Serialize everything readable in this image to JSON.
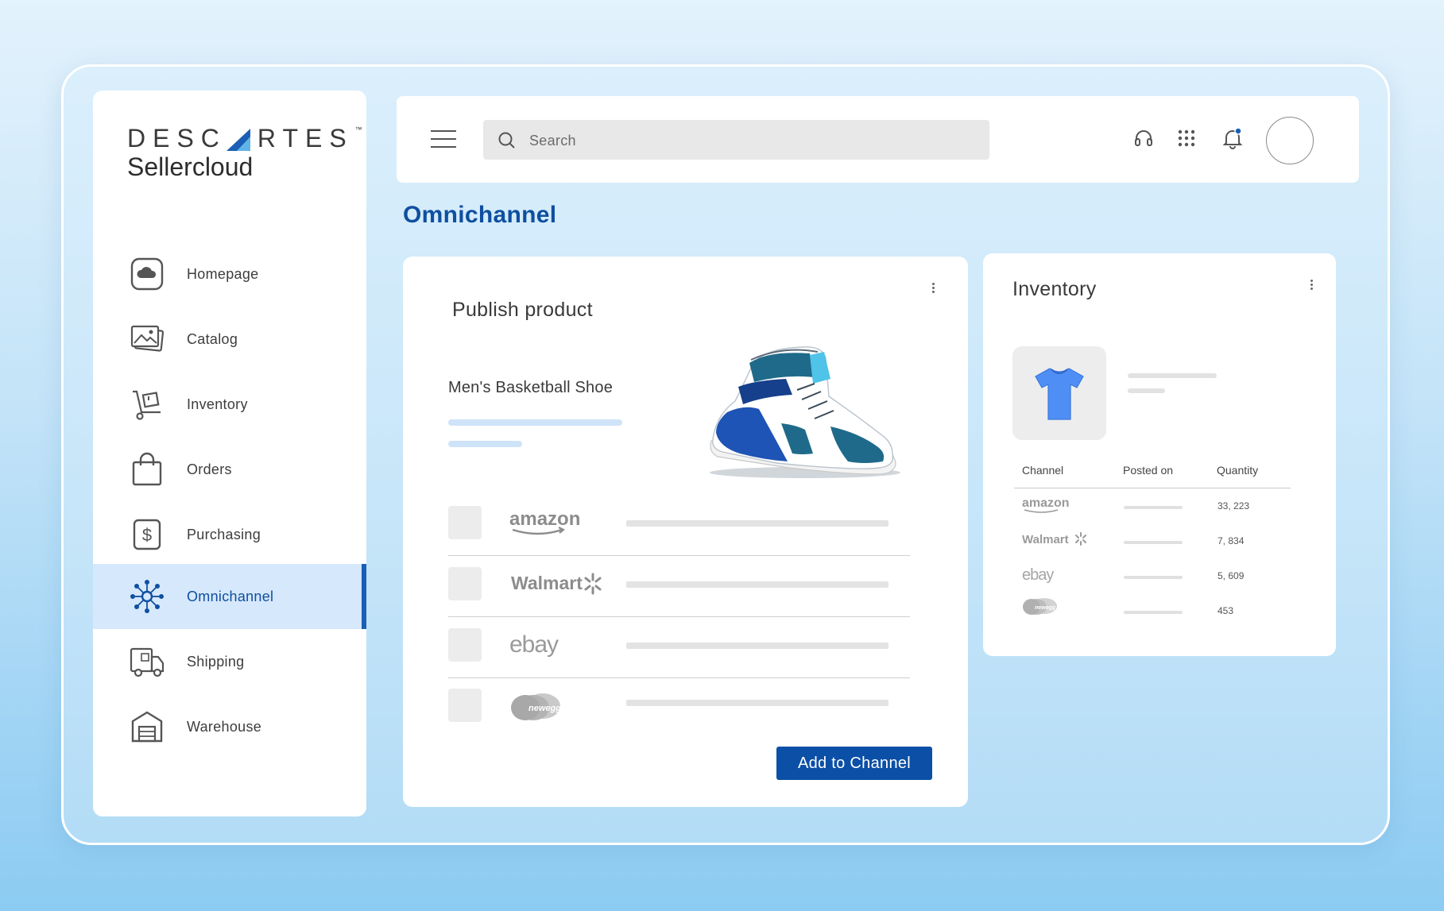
{
  "brand": {
    "name_top": "DESC",
    "name_top_rest": "RTES",
    "trademark": "™",
    "name_bottom": "Sellercloud"
  },
  "sidebar": {
    "items": [
      {
        "label": "Homepage",
        "icon": "cloud-icon",
        "active": false
      },
      {
        "label": "Catalog",
        "icon": "images-icon",
        "active": false
      },
      {
        "label": "Inventory",
        "icon": "hand-truck-icon",
        "active": false
      },
      {
        "label": "Orders",
        "icon": "shopping-bag-icon",
        "active": false
      },
      {
        "label": "Purchasing",
        "icon": "dollar-icon",
        "active": false
      },
      {
        "label": "Omnichannel",
        "icon": "network-icon",
        "active": true
      },
      {
        "label": "Shipping",
        "icon": "truck-icon",
        "active": false
      },
      {
        "label": "Warehouse",
        "icon": "warehouse-icon",
        "active": false
      }
    ]
  },
  "topbar": {
    "search_placeholder": "Search",
    "icons": [
      "menu-icon",
      "search-icon",
      "headset-icon",
      "apps-grid-icon",
      "bell-icon",
      "avatar"
    ]
  },
  "page": {
    "title": "Omnichannel"
  },
  "publish": {
    "title": "Publish product",
    "product_name": "Men's Basketball Shoe",
    "channels": [
      {
        "name": "amazon"
      },
      {
        "name": "Walmart"
      },
      {
        "name": "ebay"
      },
      {
        "name": "newegg"
      }
    ],
    "button_label": "Add to Channel"
  },
  "inventory": {
    "title": "Inventory",
    "columns": [
      "Channel",
      "Posted on",
      "Quantity"
    ],
    "rows": [
      {
        "channel": "amazon",
        "quantity": "33, 223"
      },
      {
        "channel": "Walmart",
        "quantity": "7, 834"
      },
      {
        "channel": "ebay",
        "quantity": "5, 609"
      },
      {
        "channel": "newegg",
        "quantity": "453"
      }
    ]
  },
  "colors": {
    "accent": "#0f4fa0",
    "button": "#0b4fa6",
    "active_bg": "#d6e8fb",
    "background_top": "#e3f2fc",
    "background_bottom": "#8ccbf2"
  }
}
